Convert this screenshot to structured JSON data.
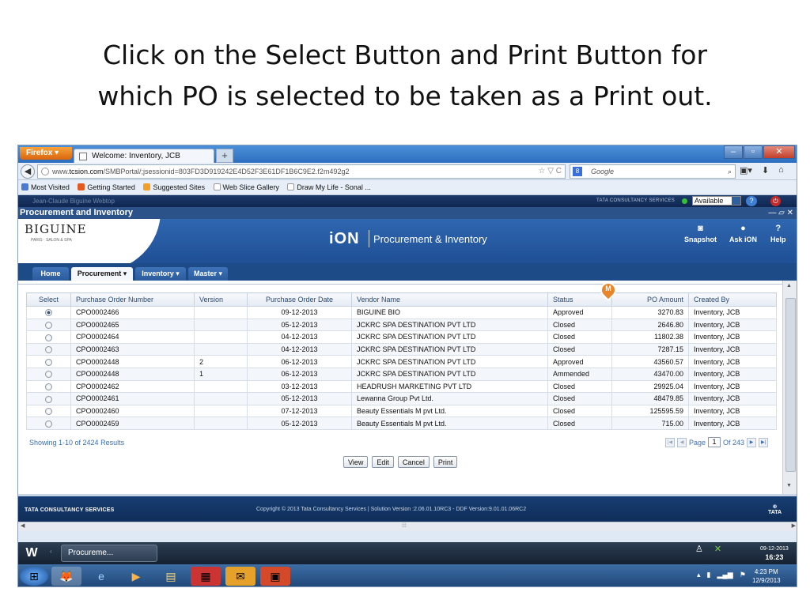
{
  "slide": {
    "title_line1": "Click on the Select Button and Print Button for",
    "title_line2": "which PO is selected to be taken as a Print out."
  },
  "browser": {
    "app_button": "Firefox ▾",
    "tab_title": "Welcome: Inventory, JCB",
    "new_tab": "+",
    "url_prefix": "www.",
    "url_host": "tcsion.com",
    "url_path": "/SMBPortal/;jsessionid=803FD3D919242E4D52F3E61DF1B6C9E2.f2m492g2",
    "url_right": "☆ ▽ C",
    "search_engine_icon": "8",
    "search_placeholder": "Google",
    "bookmarks": [
      {
        "label": "Most Visited",
        "color": "#4b7bd0"
      },
      {
        "label": "Getting Started",
        "color": "#e45a1e"
      },
      {
        "label": "Suggested Sites",
        "color": "#f0a125"
      },
      {
        "label": "Web Slice Gallery",
        "color": "#ffffff"
      },
      {
        "label": "Draw My Life - Sonal ...",
        "color": "#ffffff"
      }
    ]
  },
  "app": {
    "user_name": "Jean-Claude Biguine Webtop",
    "vendor_brand": "TATA CONSULTANCY SERVICES",
    "status": "Available",
    "section_title": "Procurement and Inventory",
    "section_controls": "— ▱ ✕",
    "logo": "BIGUINE",
    "logo_sub": "PARIS · SALON & SPA",
    "ion": "iON",
    "product": "Procurement & Inventory",
    "tools": {
      "snapshot": "Snapshot",
      "ask_ion": "Ask iON",
      "help": "Help"
    },
    "menu": [
      {
        "label": "Home"
      },
      {
        "label": "Procurement ▾"
      },
      {
        "label": "Inventory ▾"
      },
      {
        "label": "Master ▾"
      }
    ]
  },
  "grid": {
    "columns": [
      "Select",
      "Purchase Order Number",
      "Version",
      "Purchase Order Date",
      "Vendor Name",
      "Status",
      "PO Amount",
      "Created By"
    ],
    "rows": [
      {
        "po": "CPO0002466",
        "version": "",
        "date": "09-12-2013",
        "vendor": "BIGUINE BIO",
        "status": "Approved",
        "amount": "3270.83",
        "created_by": "Inventory, JCB",
        "selected": true
      },
      {
        "po": "CPO0002465",
        "version": "",
        "date": "05-12-2013",
        "vendor": "JCKRC SPA DESTINATION PVT LTD",
        "status": "Closed",
        "amount": "2646.80",
        "created_by": "Inventory, JCB",
        "selected": false
      },
      {
        "po": "CPO0002464",
        "version": "",
        "date": "04-12-2013",
        "vendor": "JCKRC SPA DESTINATION PVT LTD",
        "status": "Closed",
        "amount": "11802.38",
        "created_by": "Inventory, JCB",
        "selected": false
      },
      {
        "po": "CPO0002463",
        "version": "",
        "date": "04-12-2013",
        "vendor": "JCKRC SPA DESTINATION PVT LTD",
        "status": "Closed",
        "amount": "7287.15",
        "created_by": "Inventory, JCB",
        "selected": false
      },
      {
        "po": "CPO0002448",
        "version": "2",
        "date": "06-12-2013",
        "vendor": "JCKRC SPA DESTINATION PVT LTD",
        "status": "Approved",
        "amount": "43560.57",
        "created_by": "Inventory, JCB",
        "selected": false
      },
      {
        "po": "CPO0002448",
        "version": "1",
        "date": "06-12-2013",
        "vendor": "JCKRC SPA DESTINATION PVT LTD",
        "status": "Ammended",
        "amount": "43470.00",
        "created_by": "Inventory, JCB",
        "selected": false
      },
      {
        "po": "CPO0002462",
        "version": "",
        "date": "03-12-2013",
        "vendor": "HEADRUSH MARKETING PVT LTD",
        "status": "Closed",
        "amount": "29925.04",
        "created_by": "Inventory, JCB",
        "selected": false
      },
      {
        "po": "CPO0002461",
        "version": "",
        "date": "05-12-2013",
        "vendor": "Lewanna Group Pvt Ltd.",
        "status": "Closed",
        "amount": "48479.85",
        "created_by": "Inventory, JCB",
        "selected": false
      },
      {
        "po": "CPO0002460",
        "version": "",
        "date": "07-12-2013",
        "vendor": "Beauty Essentials M pvt Ltd.",
        "status": "Closed",
        "amount": "125595.59",
        "created_by": "Inventory, JCB",
        "selected": false
      },
      {
        "po": "CPO0002459",
        "version": "",
        "date": "05-12-2013",
        "vendor": "Beauty Essentials M pvt Ltd.",
        "status": "Closed",
        "amount": "715.00",
        "created_by": "Inventory, JCB",
        "selected": false
      }
    ],
    "marker_letter": "M"
  },
  "pagination": {
    "showing": "Showing 1-10 of 2424 Results",
    "page_label": "Page",
    "page": "1",
    "of": "Of 243"
  },
  "actions": {
    "view": "View",
    "edit": "Edit",
    "cancel": "Cancel",
    "print": "Print"
  },
  "footer": {
    "brand": "TATA CONSULTANCY SERVICES",
    "copyright": "Copyright © 2013 Tata Consultancy Services | Solution Version :2.06.01.10RC3 - DDF Version:9.01.01.06RC2",
    "tata": "TATA"
  },
  "taskbar": {
    "task_label": "Procureme...",
    "date_top": "09-12-2013",
    "time_top": "16:23",
    "clock_time": "4:23 PM",
    "clock_date": "12/9/2013"
  }
}
